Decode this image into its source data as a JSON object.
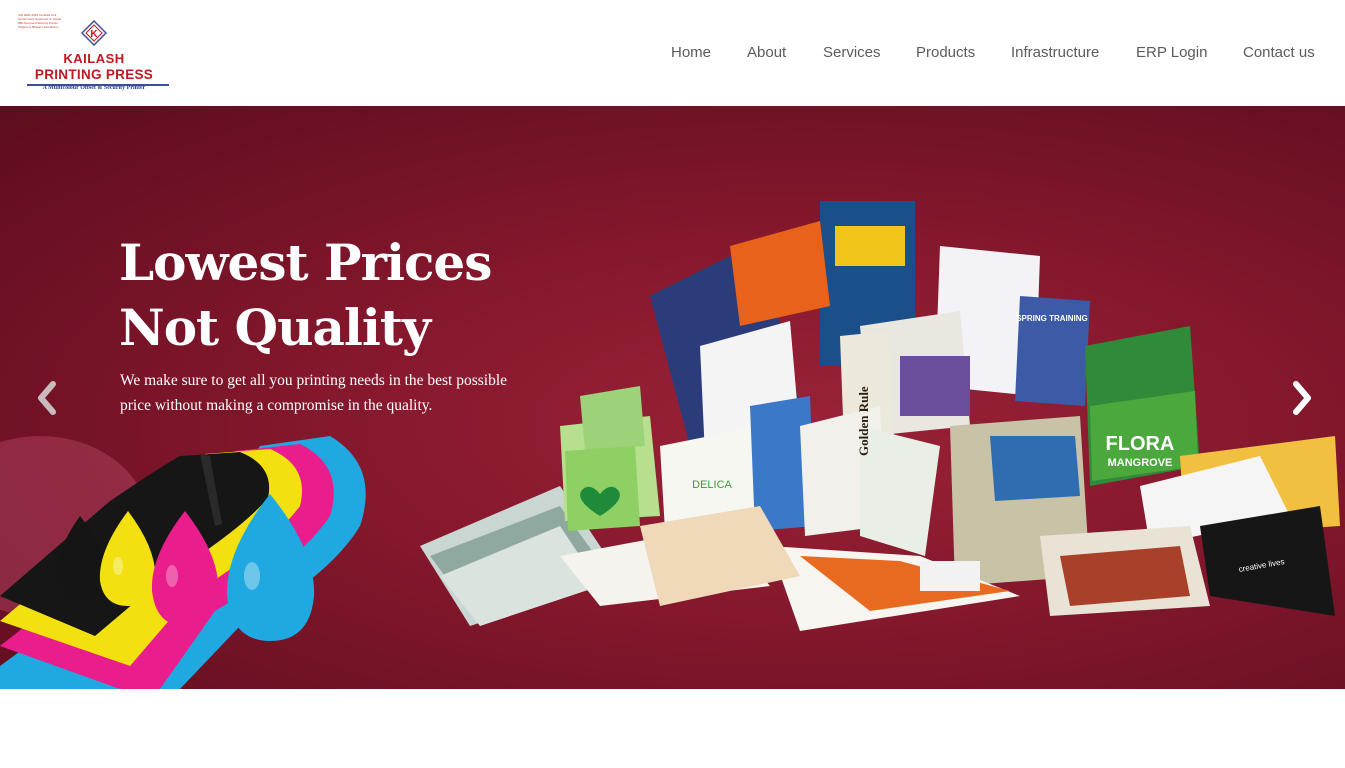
{
  "logo": {
    "cert_lines": [
      "ISO 9001:2015 Certified Unit",
      "Government Approved 'A' Grade",
      "RBI Approved Security Printer",
      "Subject to Bhiwani Jurisdiction"
    ],
    "mark": "K",
    "name_line1": "KAILASH",
    "name_line2": "PRINTING PRESS",
    "tagline": "A Multicolour Offset & Security Printer",
    "colors": {
      "red": "#c0181e",
      "blue": "#3b4fa0"
    }
  },
  "nav": {
    "items": [
      {
        "label": "Home"
      },
      {
        "label": "About"
      },
      {
        "label": "Services"
      },
      {
        "label": "Products"
      },
      {
        "label": "Infrastructure"
      },
      {
        "label": "ERP Login"
      },
      {
        "label": "Contact us"
      }
    ],
    "color": "#5b5b5b"
  },
  "hero": {
    "headline": "Lowest Prices Not Quality",
    "subtext": "We make sure to get all you printing needs in the best possible price without making a compromise in the quality.",
    "prev_icon": "chevron-left-icon",
    "next_icon": "chevron-right-icon",
    "background_color": "#86182d",
    "artwork": {
      "book_labels": [
        "FLORA",
        "MANGROVE",
        "DELICA",
        "Golden Rule",
        "SPRING TRAINING",
        "creative lives"
      ]
    }
  }
}
